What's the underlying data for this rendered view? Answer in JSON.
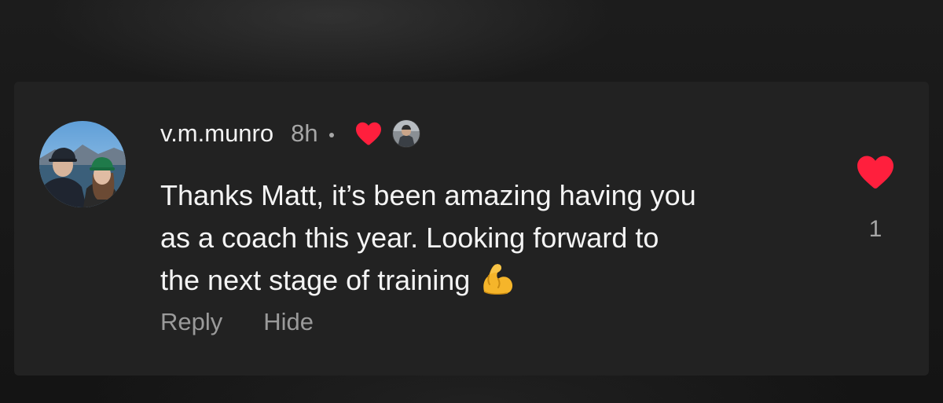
{
  "comment": {
    "username": "v.m.munro",
    "timestamp": "8h",
    "creator_liked": true,
    "body_lines": [
      "Thanks Matt, it’s been amazing having you",
      "as a coach this year. Looking forward to",
      "the next stage of training"
    ],
    "body_emoji": "flexed-biceps-emoji",
    "actions": {
      "reply_label": "Reply",
      "hide_label": "Hide"
    },
    "likes": {
      "liked": true,
      "count": "1"
    }
  },
  "colors": {
    "background": "#1a1a1a",
    "card": "#222222",
    "text_primary": "#f4f4f4",
    "text_secondary": "#9a9a9a",
    "heart_red": "#ff1f3d"
  },
  "icons": {
    "creator_heart": "heart-filled-icon",
    "like": "heart-filled-icon",
    "separator": "dot-icon"
  }
}
